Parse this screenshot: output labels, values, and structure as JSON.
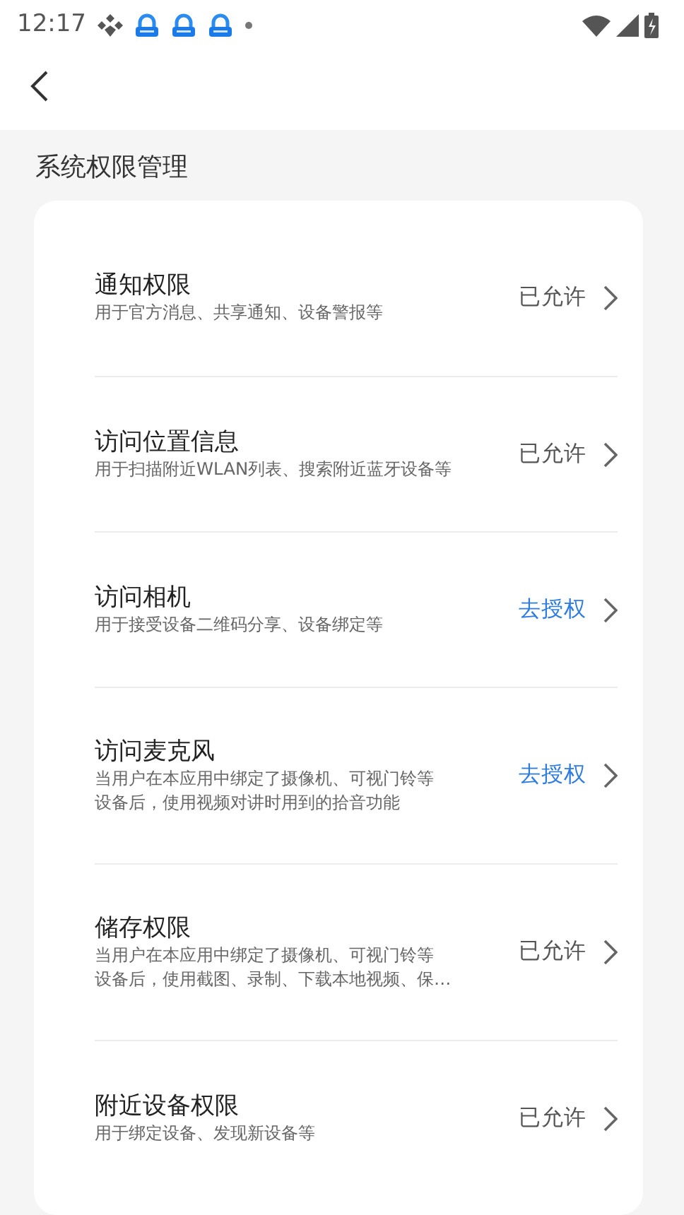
{
  "status_bar": {
    "time": "12:17"
  },
  "section_title": "系统权限管理",
  "permissions": [
    {
      "title": "通知权限",
      "description": [
        "用于官方消息、共享通知、设备警报等"
      ],
      "status": "已允许",
      "granted": true
    },
    {
      "title": "访问位置信息",
      "description": [
        "用于扫描附近WLAN列表、搜索附近蓝牙设备等"
      ],
      "status": "已允许",
      "granted": true
    },
    {
      "title": "访问相机",
      "description": [
        "用于接受设备二维码分享、设备绑定等"
      ],
      "status": "去授权",
      "granted": false
    },
    {
      "title": "访问麦克风",
      "description": [
        "当用户在本应用中绑定了摄像机、可视门铃等",
        "设备后，使用视频对讲时用到的拾音功能"
      ],
      "status": "去授权",
      "granted": false
    },
    {
      "title": "储存权限",
      "description": [
        "当用户在本应用中绑定了摄像机、可视门铃等",
        "设备后，使用截图、录制、下载本地视频、保…"
      ],
      "status": "已允许",
      "granted": true
    },
    {
      "title": "附近设备权限",
      "description": [
        "用于绑定设备、发现新设备等"
      ],
      "status": "已允许",
      "granted": true
    }
  ]
}
